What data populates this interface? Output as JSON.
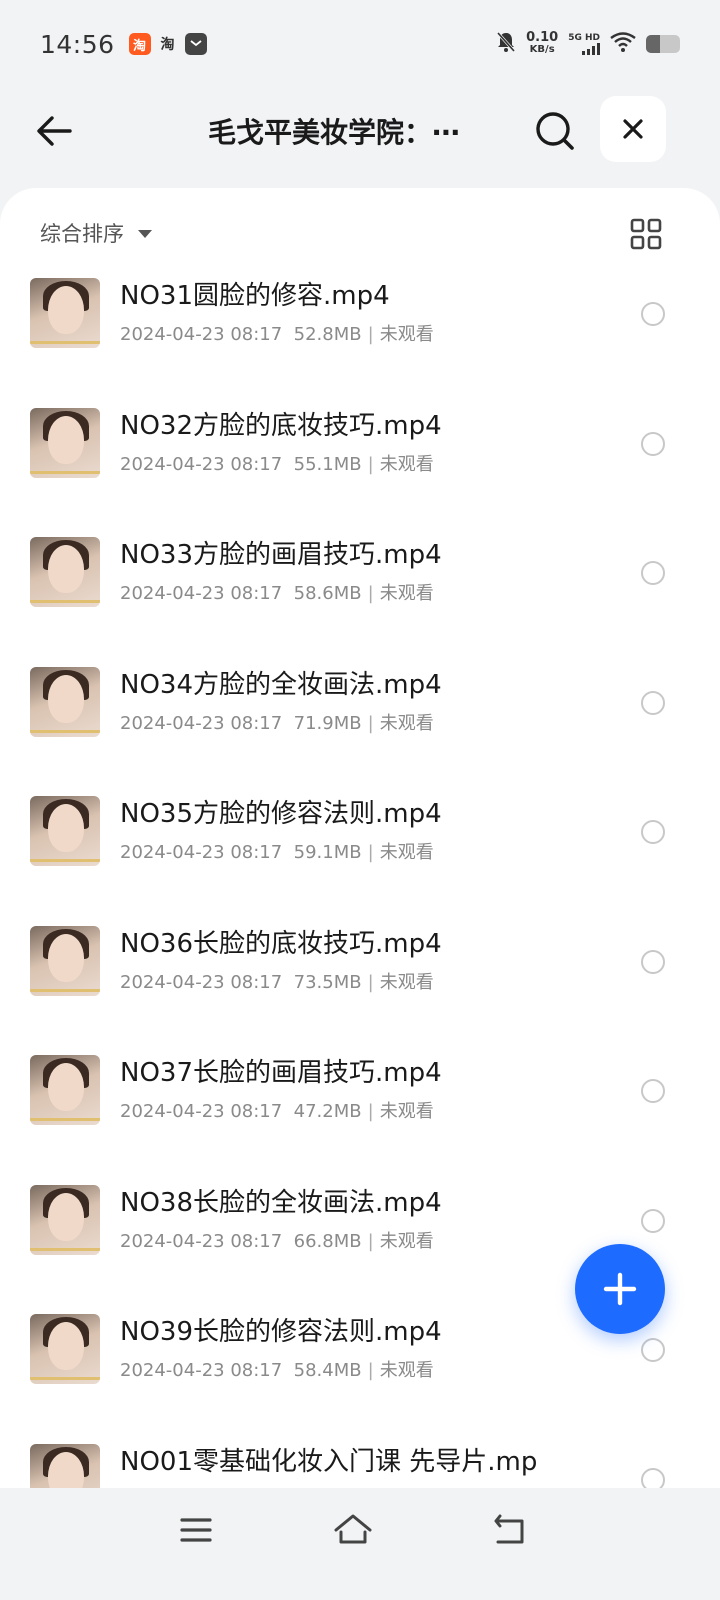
{
  "status_bar": {
    "time": "14:56",
    "app_icon_1": "淘",
    "app_icon_2": "淘",
    "net_speed_value": "0.10",
    "net_speed_unit": "KB/s",
    "signal_tag": "5G HD",
    "battery_level": 0.4
  },
  "header": {
    "title": "毛戈平美妆学院：⋯",
    "back_icon": "arrow-left-icon",
    "search_icon": "search-icon",
    "close_icon": "close-icon"
  },
  "toolbar": {
    "sort_label": "综合排序",
    "view_toggle_icon": "grid-view-icon"
  },
  "files": [
    {
      "name": "NO31圆脸的修容.mp4",
      "date": "2024-04-23 08:17",
      "size": "52.8MB",
      "status": "未观看"
    },
    {
      "name": "NO32方脸的底妆技巧.mp4",
      "date": "2024-04-23 08:17",
      "size": "55.1MB",
      "status": "未观看"
    },
    {
      "name": "NO33方脸的画眉技巧.mp4",
      "date": "2024-04-23 08:17",
      "size": "58.6MB",
      "status": "未观看"
    },
    {
      "name": "NO34方脸的全妆画法.mp4",
      "date": "2024-04-23 08:17",
      "size": "71.9MB",
      "status": "未观看"
    },
    {
      "name": "NO35方脸的修容法则.mp4",
      "date": "2024-04-23 08:17",
      "size": "59.1MB",
      "status": "未观看"
    },
    {
      "name": "NO36长脸的底妆技巧.mp4",
      "date": "2024-04-23 08:17",
      "size": "73.5MB",
      "status": "未观看"
    },
    {
      "name": "NO37长脸的画眉技巧.mp4",
      "date": "2024-04-23 08:17",
      "size": "47.2MB",
      "status": "未观看"
    },
    {
      "name": "NO38长脸的全妆画法.mp4",
      "date": "2024-04-23 08:17",
      "size": "66.8MB",
      "status": "未观看"
    },
    {
      "name": "NO39长脸的修容法则.mp4",
      "date": "2024-04-23 08:17",
      "size": "58.4MB",
      "status": "未观看"
    },
    {
      "name": "NO01零基础化妆入门课 先导片.mp",
      "date": "",
      "size": "",
      "status": ""
    }
  ],
  "fab": {
    "icon": "plus-icon"
  },
  "nav_bar": {
    "menu_icon": "menu-icon",
    "home_icon": "home-icon",
    "back_icon": "back-nav-icon"
  },
  "colors": {
    "accent": "#1d6bff",
    "background": "#f2f3f5",
    "meta_text": "#8a8a8a"
  }
}
